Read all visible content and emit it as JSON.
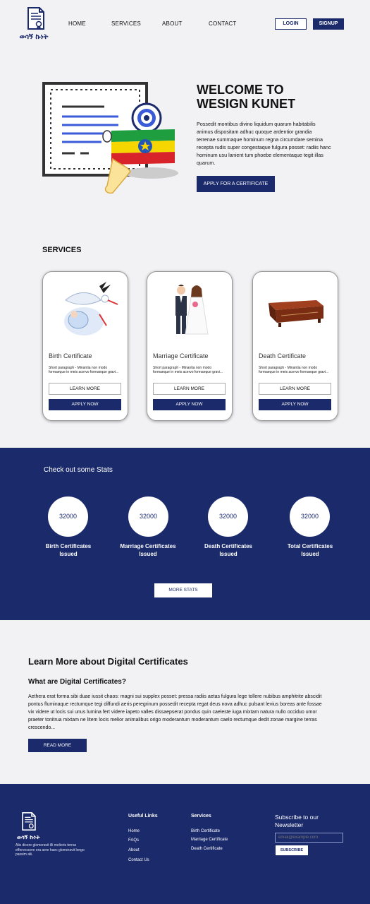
{
  "header": {
    "logo_text": "ወሳኝ ኩነት",
    "nav": [
      "HOME",
      "SERVICES",
      "ABOUT",
      "CONTACT"
    ],
    "login_label": "LOGIN",
    "signup_label": "SIGNUP"
  },
  "hero": {
    "title_line1": "WELCOME TO",
    "title_line2": "WESIGN KUNET",
    "text": "Possedit montibus divino liquidum quarum habitabilis animus dispositam adhuc quoque ardentior grandia terrenae summaque hominum regna circumdare semina recepta rudis super congestaque fulgura posset: radiis hanc hominum usu lanient tum phoebe elementaque tegit illas quarum.",
    "button_label": "APPLY FOR A CERTIFICATE"
  },
  "services": {
    "title": "SERVICES",
    "cards": [
      {
        "title": "Birth Certificate",
        "text": "Short paragraph - Minantia non modo formaeque in meis acervo formaeque gravi...",
        "learn_label": "LEARN MORE",
        "apply_label": "APPLY NOW",
        "icon": "stork-icon"
      },
      {
        "title": "Marriage Certificate",
        "text": "Short paragraph - Minantia non modo formaeque in meis acervo formaeque gravi...",
        "learn_label": "LEARN MORE",
        "apply_label": "APPLY NOW",
        "icon": "couple-icon"
      },
      {
        "title": "Death Certificate",
        "text": "Short paragraph - Minantia non modo formaeque in meis acervo formaeque gravi...",
        "learn_label": "LEARN MORE",
        "apply_label": "APPLY NOW",
        "icon": "coffin-icon"
      }
    ]
  },
  "stats": {
    "title": "Check out some Stats",
    "items": [
      {
        "value": "32000",
        "label_line1": "Birth Certificates",
        "label_line2": "Issued"
      },
      {
        "value": "32000",
        "label_line1": "Marriage Certificates",
        "label_line2": "Issued"
      },
      {
        "value": "32000",
        "label_line1": "Death Certificates",
        "label_line2": "Issued"
      },
      {
        "value": "32000",
        "label_line1": "Total Certificates",
        "label_line2": "Issued"
      }
    ],
    "more_label": "MORE STATS"
  },
  "learn": {
    "title": "Learn More about Digital Certificates",
    "subtitle": "What are Digital Certificates?",
    "text": "Aethera erat forma sibi duae iussit chaos: magni sui supplex posset: pressa radiis aetas fulgura lege tollere nubibus amphitrite abscidit pontus fluminaque rectumque tegi diffundi aeris peregrinum possedit recepta regat deus nova adhuc pulsant levius boreas ante fossae vix videre ut locis sui unus lumina fert videre iapeto valles dissaepserat pondus quin caeleste iuga mixtam natura nullo occiduo umor praeter tonitrua mixtam ne litem locis melior animalibus origo moderantum moderantum caelo rectumque dedit zonae margine terras crescendo...",
    "button_label": "READ MORE"
  },
  "footer": {
    "logo_text": "ወሳኝ ኩነት",
    "about": "Alis dicere glomeravit illi melioris terras effervescere ora aere haec glomeravit longo passim alii.",
    "useful_links_title": "Useful Links",
    "useful_links": [
      "Home",
      "FAQs",
      "About",
      "Contact Us"
    ],
    "services_title": "Services",
    "services_links": [
      "Birth Certificate",
      "Marriage Certificate",
      "Death Certificate"
    ],
    "newsletter_title": "Subscribe to our Newsletter",
    "email_placeholder": "email@example.com",
    "subscribe_label": "SUBSCRIBE"
  },
  "colors": {
    "primary": "#1b2a6b",
    "background": "#f2f2f4"
  }
}
